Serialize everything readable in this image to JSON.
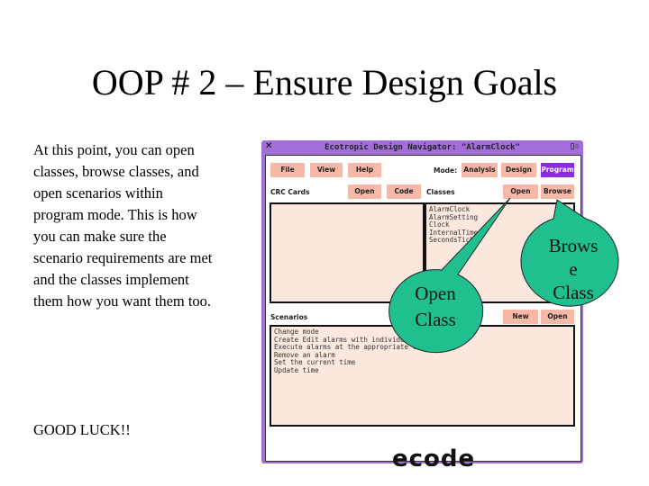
{
  "slide": {
    "title": "OOP # 2 – Ensure Design Goals",
    "body": "At this point, you can open classes, browse classes, and open scenarios within program mode.  This is how you can make sure the scenario requirements are met and the classes implement them how you want them too.",
    "closing": "GOOD LUCK!!"
  },
  "window": {
    "title": "Ecotropic Design Navigator: \"AlarmClock\"",
    "menu": [
      "File",
      "View",
      "Help"
    ],
    "mode_label": "Mode:",
    "modes": [
      "Analysis",
      "Design",
      "Program"
    ],
    "selected_mode": "Program",
    "crc_label": "CRC Cards",
    "crc_buttons": [
      "Open",
      "Code"
    ],
    "classes_label": "Classes",
    "classes_buttons": [
      "Open",
      "Browse"
    ],
    "classes": [
      "AlarmClock",
      "AlarmSetting",
      "Clock",
      "InternalTime",
      "SecondsTicker"
    ],
    "scenarios_label": "Scenarios",
    "scenario_buttons": [
      "New",
      "Open"
    ],
    "scenarios": [
      "Change mode",
      "Create Edit alarms with individual ...",
      "Execute alarms at the appropriate times",
      "Remove an alarm",
      "Set the current time",
      "Update time"
    ],
    "logo": "ecode",
    "accent": "#8a2be2"
  },
  "callouts": {
    "open_class": [
      "Open",
      "Class"
    ],
    "browse_class": [
      "Brows",
      "e",
      "Class"
    ],
    "color": "#1fbf8f"
  }
}
